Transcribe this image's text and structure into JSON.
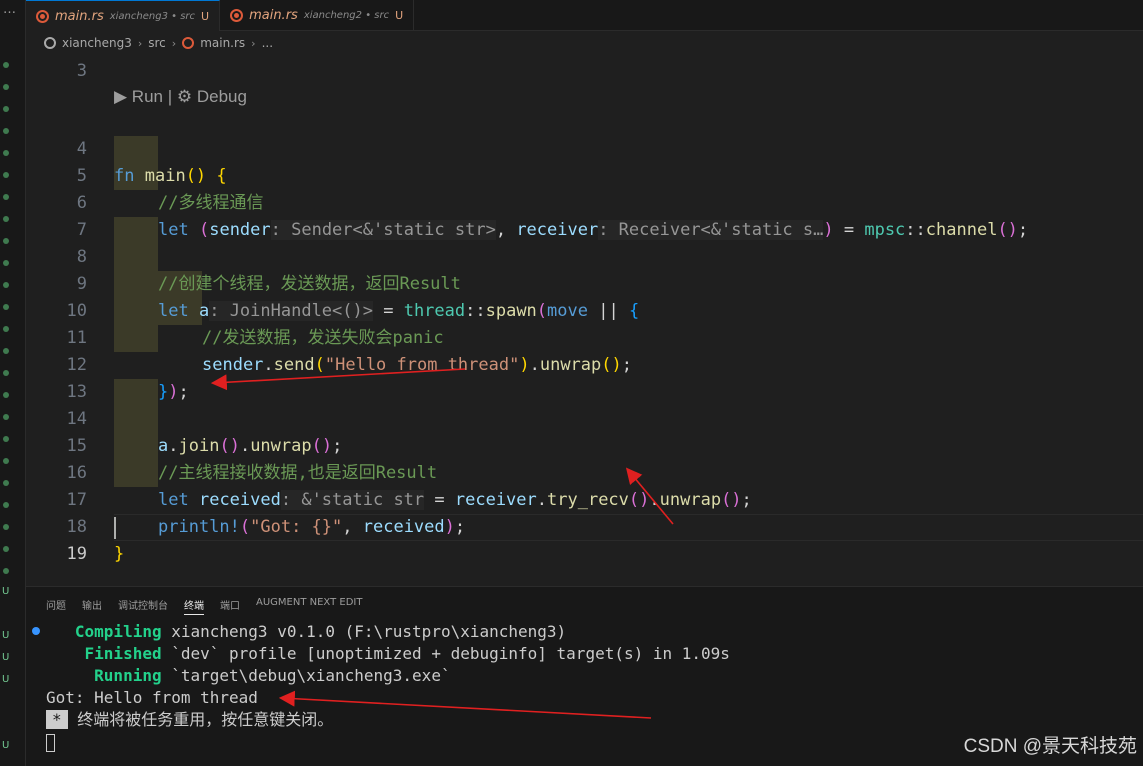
{
  "tabs": [
    {
      "filename": "main.rs",
      "path": "xiancheng3 • src",
      "status": "U"
    },
    {
      "filename": "main.rs",
      "path": "xiancheng2 • src",
      "status": "U"
    }
  ],
  "breadcrumb": [
    "xiancheng3",
    "src",
    "main.rs",
    "..."
  ],
  "codelens": {
    "run": "Run",
    "sep": "|",
    "debug": "Debug"
  },
  "line_numbers": [
    "3",
    "4",
    "5",
    "6",
    "7",
    "8",
    "9",
    "10",
    "11",
    "12",
    "13",
    "14",
    "15",
    "16",
    "17",
    "18",
    "19"
  ],
  "code": {
    "l4_fn": "fn",
    "l4_name": "main",
    "l4_paren": "()",
    "l4_brace": "{",
    "l5": "//多线程通信",
    "l6_let": "let",
    "l6_open": "(",
    "l6_sender": "sender",
    "l6_sender_hint": ": Sender<&'static str>",
    "l6_comma": ",",
    "l6_receiver": "receiver",
    "l6_receiver_hint": ": Receiver<&'static s…",
    "l6_close": ")",
    "l6_eq": " = ",
    "l6_mod": "mpsc",
    "l6_colons": "::",
    "l6_call": "channel",
    "l6_paren": "()",
    "l6_semi": ";",
    "l8": "//创建个线程，发送数据，返回Result",
    "l9_let": "let",
    "l9_a": "a",
    "l9_hint": ": JoinHandle<()>",
    "l9_eq": " = ",
    "l9_mod": "thread",
    "l9_colons": "::",
    "l9_call": "spawn",
    "l9_open": "(",
    "l9_move": "move",
    "l9_pipes": " || ",
    "l9_brace": "{",
    "l10": "//发送数据，发送失败会panic",
    "l11_var": "sender",
    "l11_dot": ".",
    "l11_send": "send",
    "l11_open": "(",
    "l11_str": "\"Hello from thread\"",
    "l11_close": ")",
    "l11_dot2": ".",
    "l11_unwrap": "unwrap",
    "l11_paren": "()",
    "l11_semi": ";",
    "l12_brace": "}",
    "l12_paren": ")",
    "l12_semi": ";",
    "l14_a": "a",
    "l14_dot": ".",
    "l14_join": "join",
    "l14_paren": "()",
    "l14_dot2": ".",
    "l14_unwrap": "unwrap",
    "l14_paren2": "()",
    "l14_semi": ";",
    "l15": "//主线程接收数据,也是返回Result",
    "l16_let": "let",
    "l16_var": "received",
    "l16_hint": ": &'static str",
    "l16_eq": " = ",
    "l16_recv": "receiver",
    "l16_dot": ".",
    "l16_try": "try_recv",
    "l16_paren": "()",
    "l16_dot2": ".",
    "l16_unwrap": "unwrap",
    "l16_paren2": "()",
    "l16_semi": ";",
    "l17_mac": "println!",
    "l17_open": "(",
    "l17_str": "\"Got: {}\"",
    "l17_comma": ", ",
    "l17_var": "received",
    "l17_close": ")",
    "l17_semi": ";",
    "l18": "}"
  },
  "panel": {
    "tabs": [
      "问题",
      "输出",
      "调试控制台",
      "终端",
      "端口",
      "AUGMENT NEXT EDIT"
    ],
    "active_tab": "终端"
  },
  "terminal": {
    "l1_label": "   Compiling",
    "l1_text": " xiancheng3 v0.1.0 (F:\\rustpro\\xiancheng3)",
    "l2_label": "    Finished",
    "l2_text": " `dev` profile [unoptimized + debuginfo] target(s) in 1.09s",
    "l3_label": "     Running",
    "l3_text": " `target\\debug\\xiancheng3.exe`",
    "l4": "Got: Hello from thread",
    "l5_star": "*",
    "l5_text": " 终端将被任务重用，按任意键关闭。"
  },
  "watermark": "CSDN @景天科技苑"
}
